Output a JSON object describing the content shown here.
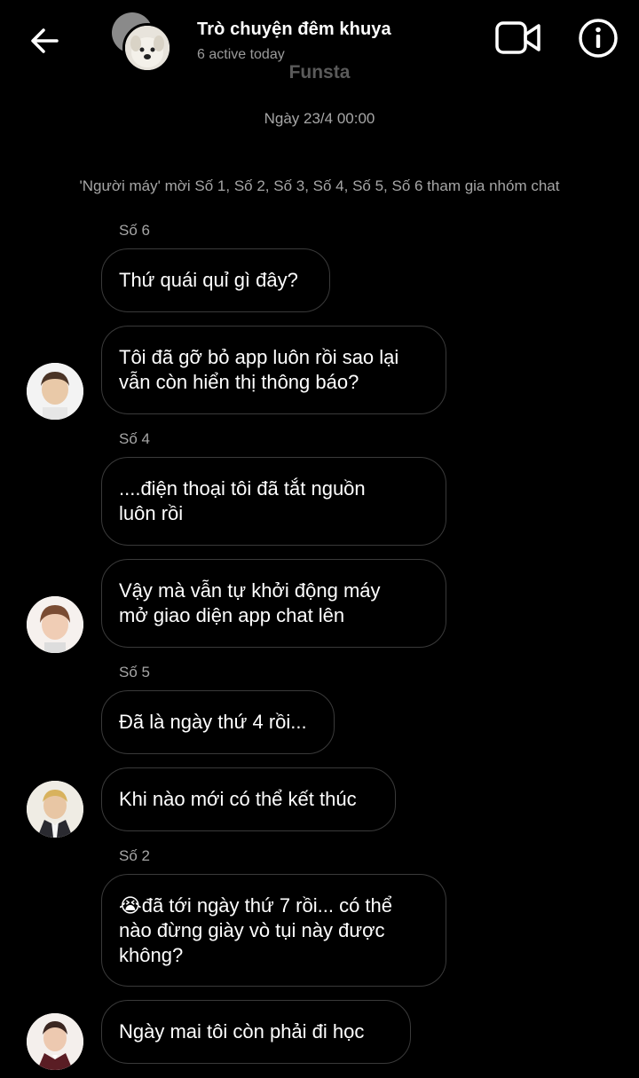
{
  "header": {
    "title": "Trò chuyện đêm khuya",
    "subtitle": "6 active today",
    "brand_watermark": "Funsta"
  },
  "thread": {
    "date_label": "Ngày 23/4 00:00",
    "system_message": "'Người máy' mời Số 1, Số 2, Số 3, Số 4, Số 5, Số 6 tham gia nhóm chat"
  },
  "groups": [
    {
      "sender": "Số 6",
      "messages": [
        "Thứ quái quỉ gì đây?",
        "Tôi đã gỡ bỏ app luôn rồi sao lại\nvẫn còn hiển thị thông báo?"
      ]
    },
    {
      "sender": "Số 4",
      "messages": [
        "....điện thoại tôi đã tắt nguồn\nluôn rồi",
        "Vậy mà vẫn tự khởi động máy\nmở giao diện app chat lên"
      ]
    },
    {
      "sender": "Số 5",
      "messages": [
        "Đã là ngày thứ 4 rồi...",
        "Khi nào mới có thể kết thúc"
      ]
    },
    {
      "sender": "Số 2",
      "messages": [
        "😭đã tới ngày thứ 7 rồi... có thể\nnào đừng giày vò tụi này được\nkhông?",
        "Ngày mai tôi còn phải đi học"
      ]
    }
  ],
  "colors": {
    "background": "#000000",
    "bubble_border": "#3a3a3a",
    "secondary_text": "#a6a6a6"
  },
  "icons": {
    "back": "arrow-left-icon",
    "video": "video-camera-icon",
    "info": "info-icon"
  }
}
